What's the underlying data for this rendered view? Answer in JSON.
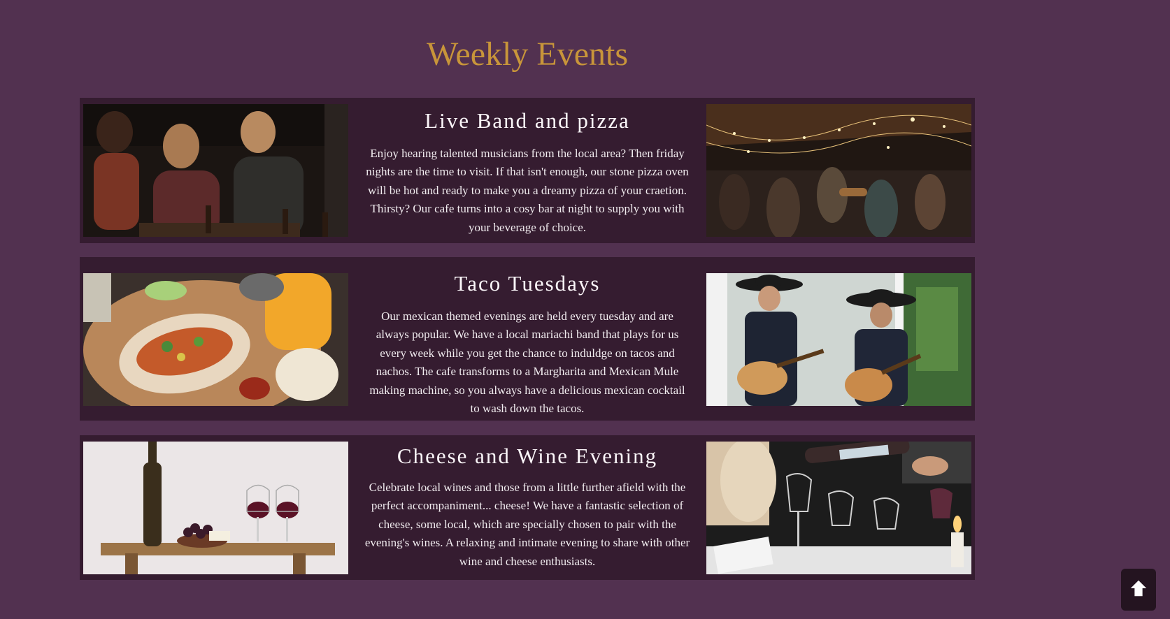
{
  "page": {
    "title": "Weekly Events"
  },
  "events": [
    {
      "title": "Live Band and pizza",
      "description": "Enjoy hearing talented musicians from the local area? Then friday nights are the time to visit. If that isn't enough, our stone pizza oven will be hot and ready to make you a dreamy pizza of your craetion. Thirsty? Our cafe turns into a cosy bar at night to supply you with your beverage of choice.",
      "left_image": "friends-eating-pizza-photo",
      "right_image": "live-band-under-string-lights-photo"
    },
    {
      "title": "Taco Tuesdays",
      "description": "Our mexican themed evenings are held every tuesday and are always popular. We have a local mariachi band that plays for us every week while you get the chance to induldge on tacos and nachos. The cafe transforms to a Margharita and Mexican Mule making machine, so you always have a delicious mexican cocktail to wash down the tacos.",
      "left_image": "tacos-and-drink-photo",
      "right_image": "mariachi-guitarists-photo"
    },
    {
      "title": "Cheese and Wine Evening",
      "description": "Celebrate local wines and those from a little further afield with the perfect accompaniment... cheese! We have a fantastic selection of cheese, some local, which are specially chosen to pair with the evening's wines. A relaxing and intimate evening to share with other wine and cheese enthusiasts.",
      "left_image": "wine-bottle-grapes-cheese-photo",
      "right_image": "pouring-wine-glasses-photo"
    }
  ],
  "scroll_top": {
    "icon": "arrow-up-icon"
  },
  "colors": {
    "background": "#523150",
    "card": "#351c30",
    "title_gold": "#c8953a",
    "text": "#ffffff"
  }
}
